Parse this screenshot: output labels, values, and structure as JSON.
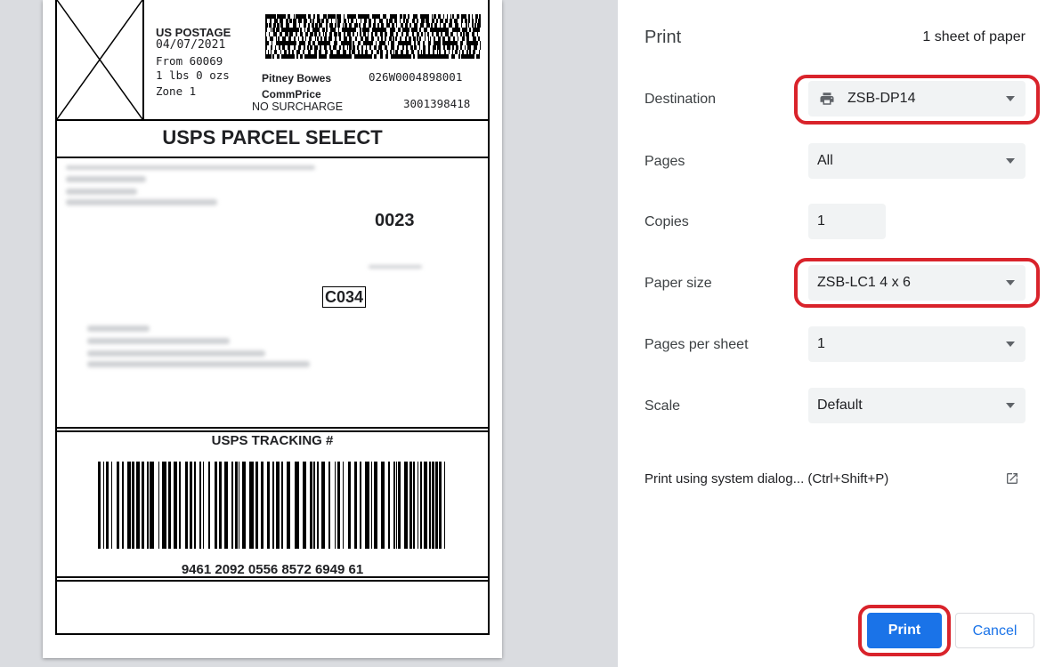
{
  "label": {
    "postage_title": "US POSTAGE",
    "date": "04/07/2021",
    "from": "From 60069",
    "weight": "1 lbs 0 ozs",
    "zone": "Zone 1",
    "carrier": "Pitney Bowes",
    "price_type": "CommPrice",
    "surcharge": "NO SURCHARGE",
    "meter_number": "026W0004898001",
    "account_number": "3001398418",
    "service": "USPS PARCEL SELECT",
    "route_code": "0023",
    "zone_code": "C034",
    "tracking_heading": "USPS TRACKING #",
    "tracking_number": "9461 2092 0556 8572 6949 61"
  },
  "print_panel": {
    "title": "Print",
    "sheet_count": "1 sheet of paper",
    "destination": {
      "label": "Destination",
      "value": "ZSB-DP14",
      "icon": "printer-icon"
    },
    "pages": {
      "label": "Pages",
      "value": "All"
    },
    "copies": {
      "label": "Copies",
      "value": "1"
    },
    "paper_size": {
      "label": "Paper size",
      "value": "ZSB-LC1 4 x 6"
    },
    "pages_per_sheet": {
      "label": "Pages per sheet",
      "value": "1"
    },
    "scale": {
      "label": "Scale",
      "value": "Default"
    },
    "system_dialog": {
      "label": "Print using system dialog... (Ctrl+Shift+P)",
      "icon": "open-external-icon"
    },
    "print_button": "Print",
    "cancel_button": "Cancel"
  },
  "colors": {
    "accent": "#1a73e8",
    "highlight_ring": "#d9232b",
    "field_bg": "#f1f3f4"
  }
}
